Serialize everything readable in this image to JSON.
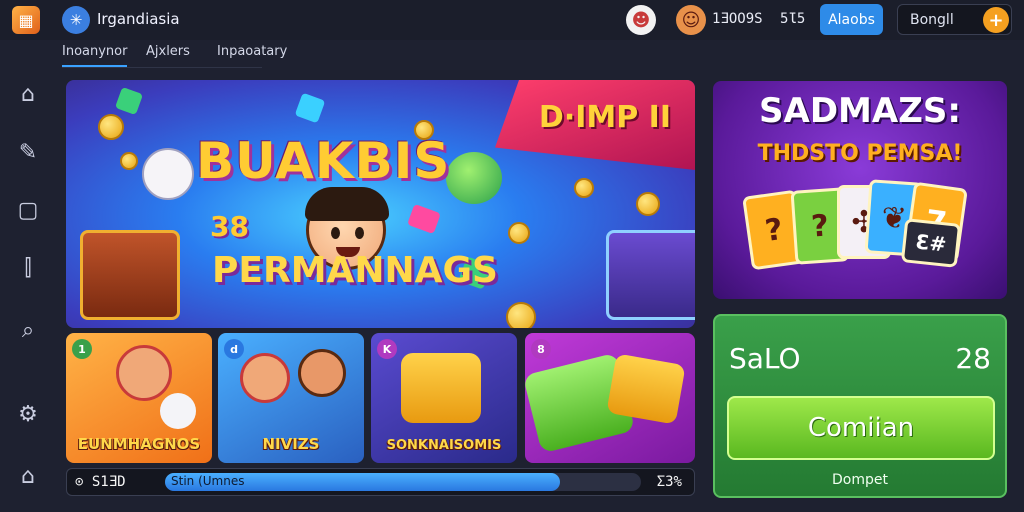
{
  "header": {
    "brand": "Irgandiasia",
    "stats": [
      "1ƎOO9S",
      "5Ɩ5"
    ],
    "blue_button": "Alaobs",
    "search_value": "Bongll",
    "plus": "+"
  },
  "tabs": [
    "Inoanynor",
    "Ajxlers",
    "Inpaoatary"
  ],
  "hero": {
    "ribbon": "D·IMP II",
    "title": "BUAKBIS",
    "number": "38",
    "subtitle": "PERMANNAGS"
  },
  "promo": {
    "title": "SADMAZS:",
    "subtitle": "THDSTO PEMSA!",
    "cards": [
      "?",
      "?",
      "✣",
      "❦",
      "7",
      "Ɛ#"
    ]
  },
  "tiles": [
    {
      "badge": "1",
      "title": "EUNMHAGNOS",
      "badge_color": "#3aa04a"
    },
    {
      "badge": "d",
      "title": "NIVIZS",
      "badge_color": "#2a78e0"
    },
    {
      "badge": "K",
      "title": "SONKNAISOMIS",
      "badge_color": "#b03ac0"
    },
    {
      "badge": "8",
      "title": "",
      "badge_color": "#b03ac0"
    }
  ],
  "bottom_bar": {
    "left": "⊙ S1ƎD",
    "progress_label": "Stin (Umnes",
    "progress_fraction": 0.83,
    "right": "Ʃ3%"
  },
  "score_panel": {
    "label": "SaLO",
    "value": "28",
    "button": "Comiian",
    "footer": "Dompet"
  },
  "colors": {
    "background": "#1e2130",
    "accent_blue": "#2e8be8",
    "accent_green": "#3aa04a",
    "accent_orange": "#f5a020"
  }
}
